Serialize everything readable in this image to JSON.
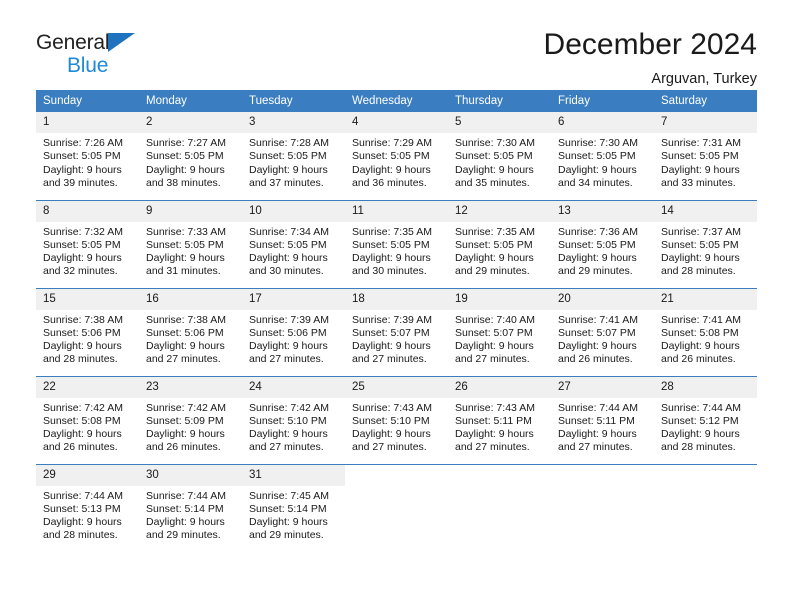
{
  "brand": {
    "name_line1": "General",
    "name_line2": "Blue",
    "accent_color": "#2089d8",
    "triangle_color": "#1f72bd"
  },
  "header": {
    "title": "December 2024",
    "subtitle": "Arguvan, Turkey"
  },
  "calendar": {
    "header_bg": "#3a7dc0",
    "header_text_color": "#ffffff",
    "daynum_bg": "#f0f0f0",
    "weekdays": [
      "Sunday",
      "Monday",
      "Tuesday",
      "Wednesday",
      "Thursday",
      "Friday",
      "Saturday"
    ],
    "weeks": [
      [
        {
          "day": "1",
          "sunrise": "Sunrise: 7:26 AM",
          "sunset": "Sunset: 5:05 PM",
          "daylight1": "Daylight: 9 hours",
          "daylight2": "and 39 minutes."
        },
        {
          "day": "2",
          "sunrise": "Sunrise: 7:27 AM",
          "sunset": "Sunset: 5:05 PM",
          "daylight1": "Daylight: 9 hours",
          "daylight2": "and 38 minutes."
        },
        {
          "day": "3",
          "sunrise": "Sunrise: 7:28 AM",
          "sunset": "Sunset: 5:05 PM",
          "daylight1": "Daylight: 9 hours",
          "daylight2": "and 37 minutes."
        },
        {
          "day": "4",
          "sunrise": "Sunrise: 7:29 AM",
          "sunset": "Sunset: 5:05 PM",
          "daylight1": "Daylight: 9 hours",
          "daylight2": "and 36 minutes."
        },
        {
          "day": "5",
          "sunrise": "Sunrise: 7:30 AM",
          "sunset": "Sunset: 5:05 PM",
          "daylight1": "Daylight: 9 hours",
          "daylight2": "and 35 minutes."
        },
        {
          "day": "6",
          "sunrise": "Sunrise: 7:30 AM",
          "sunset": "Sunset: 5:05 PM",
          "daylight1": "Daylight: 9 hours",
          "daylight2": "and 34 minutes."
        },
        {
          "day": "7",
          "sunrise": "Sunrise: 7:31 AM",
          "sunset": "Sunset: 5:05 PM",
          "daylight1": "Daylight: 9 hours",
          "daylight2": "and 33 minutes."
        }
      ],
      [
        {
          "day": "8",
          "sunrise": "Sunrise: 7:32 AM",
          "sunset": "Sunset: 5:05 PM",
          "daylight1": "Daylight: 9 hours",
          "daylight2": "and 32 minutes."
        },
        {
          "day": "9",
          "sunrise": "Sunrise: 7:33 AM",
          "sunset": "Sunset: 5:05 PM",
          "daylight1": "Daylight: 9 hours",
          "daylight2": "and 31 minutes."
        },
        {
          "day": "10",
          "sunrise": "Sunrise: 7:34 AM",
          "sunset": "Sunset: 5:05 PM",
          "daylight1": "Daylight: 9 hours",
          "daylight2": "and 30 minutes."
        },
        {
          "day": "11",
          "sunrise": "Sunrise: 7:35 AM",
          "sunset": "Sunset: 5:05 PM",
          "daylight1": "Daylight: 9 hours",
          "daylight2": "and 30 minutes."
        },
        {
          "day": "12",
          "sunrise": "Sunrise: 7:35 AM",
          "sunset": "Sunset: 5:05 PM",
          "daylight1": "Daylight: 9 hours",
          "daylight2": "and 29 minutes."
        },
        {
          "day": "13",
          "sunrise": "Sunrise: 7:36 AM",
          "sunset": "Sunset: 5:05 PM",
          "daylight1": "Daylight: 9 hours",
          "daylight2": "and 29 minutes."
        },
        {
          "day": "14",
          "sunrise": "Sunrise: 7:37 AM",
          "sunset": "Sunset: 5:05 PM",
          "daylight1": "Daylight: 9 hours",
          "daylight2": "and 28 minutes."
        }
      ],
      [
        {
          "day": "15",
          "sunrise": "Sunrise: 7:38 AM",
          "sunset": "Sunset: 5:06 PM",
          "daylight1": "Daylight: 9 hours",
          "daylight2": "and 28 minutes."
        },
        {
          "day": "16",
          "sunrise": "Sunrise: 7:38 AM",
          "sunset": "Sunset: 5:06 PM",
          "daylight1": "Daylight: 9 hours",
          "daylight2": "and 27 minutes."
        },
        {
          "day": "17",
          "sunrise": "Sunrise: 7:39 AM",
          "sunset": "Sunset: 5:06 PM",
          "daylight1": "Daylight: 9 hours",
          "daylight2": "and 27 minutes."
        },
        {
          "day": "18",
          "sunrise": "Sunrise: 7:39 AM",
          "sunset": "Sunset: 5:07 PM",
          "daylight1": "Daylight: 9 hours",
          "daylight2": "and 27 minutes."
        },
        {
          "day": "19",
          "sunrise": "Sunrise: 7:40 AM",
          "sunset": "Sunset: 5:07 PM",
          "daylight1": "Daylight: 9 hours",
          "daylight2": "and 27 minutes."
        },
        {
          "day": "20",
          "sunrise": "Sunrise: 7:41 AM",
          "sunset": "Sunset: 5:07 PM",
          "daylight1": "Daylight: 9 hours",
          "daylight2": "and 26 minutes."
        },
        {
          "day": "21",
          "sunrise": "Sunrise: 7:41 AM",
          "sunset": "Sunset: 5:08 PM",
          "daylight1": "Daylight: 9 hours",
          "daylight2": "and 26 minutes."
        }
      ],
      [
        {
          "day": "22",
          "sunrise": "Sunrise: 7:42 AM",
          "sunset": "Sunset: 5:08 PM",
          "daylight1": "Daylight: 9 hours",
          "daylight2": "and 26 minutes."
        },
        {
          "day": "23",
          "sunrise": "Sunrise: 7:42 AM",
          "sunset": "Sunset: 5:09 PM",
          "daylight1": "Daylight: 9 hours",
          "daylight2": "and 26 minutes."
        },
        {
          "day": "24",
          "sunrise": "Sunrise: 7:42 AM",
          "sunset": "Sunset: 5:10 PM",
          "daylight1": "Daylight: 9 hours",
          "daylight2": "and 27 minutes."
        },
        {
          "day": "25",
          "sunrise": "Sunrise: 7:43 AM",
          "sunset": "Sunset: 5:10 PM",
          "daylight1": "Daylight: 9 hours",
          "daylight2": "and 27 minutes."
        },
        {
          "day": "26",
          "sunrise": "Sunrise: 7:43 AM",
          "sunset": "Sunset: 5:11 PM",
          "daylight1": "Daylight: 9 hours",
          "daylight2": "and 27 minutes."
        },
        {
          "day": "27",
          "sunrise": "Sunrise: 7:44 AM",
          "sunset": "Sunset: 5:11 PM",
          "daylight1": "Daylight: 9 hours",
          "daylight2": "and 27 minutes."
        },
        {
          "day": "28",
          "sunrise": "Sunrise: 7:44 AM",
          "sunset": "Sunset: 5:12 PM",
          "daylight1": "Daylight: 9 hours",
          "daylight2": "and 28 minutes."
        }
      ],
      [
        {
          "day": "29",
          "sunrise": "Sunrise: 7:44 AM",
          "sunset": "Sunset: 5:13 PM",
          "daylight1": "Daylight: 9 hours",
          "daylight2": "and 28 minutes."
        },
        {
          "day": "30",
          "sunrise": "Sunrise: 7:44 AM",
          "sunset": "Sunset: 5:14 PM",
          "daylight1": "Daylight: 9 hours",
          "daylight2": "and 29 minutes."
        },
        {
          "day": "31",
          "sunrise": "Sunrise: 7:45 AM",
          "sunset": "Sunset: 5:14 PM",
          "daylight1": "Daylight: 9 hours",
          "daylight2": "and 29 minutes."
        },
        {
          "day": "",
          "sunrise": "",
          "sunset": "",
          "daylight1": "",
          "daylight2": ""
        },
        {
          "day": "",
          "sunrise": "",
          "sunset": "",
          "daylight1": "",
          "daylight2": ""
        },
        {
          "day": "",
          "sunrise": "",
          "sunset": "",
          "daylight1": "",
          "daylight2": ""
        },
        {
          "day": "",
          "sunrise": "",
          "sunset": "",
          "daylight1": "",
          "daylight2": ""
        }
      ]
    ]
  }
}
